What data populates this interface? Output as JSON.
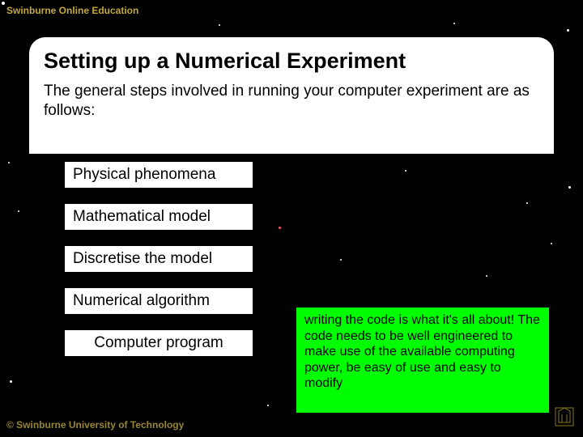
{
  "brand": "Swinburne Online Education",
  "title": "Setting up a Numerical Experiment",
  "intro": "The general steps involved in running your computer experiment are as follows:",
  "steps": [
    {
      "label": "Physical phenomena"
    },
    {
      "label": "Mathematical model"
    },
    {
      "label": "Discretise the model"
    },
    {
      "label": "Numerical algorithm"
    },
    {
      "label": "Computer program"
    }
  ],
  "callout": "writing the code is what it's all about!  The code needs to be well engineered to make use of the available computing power, be easy of use and easy to modify",
  "copyright": "© Swinburne University of Technology"
}
